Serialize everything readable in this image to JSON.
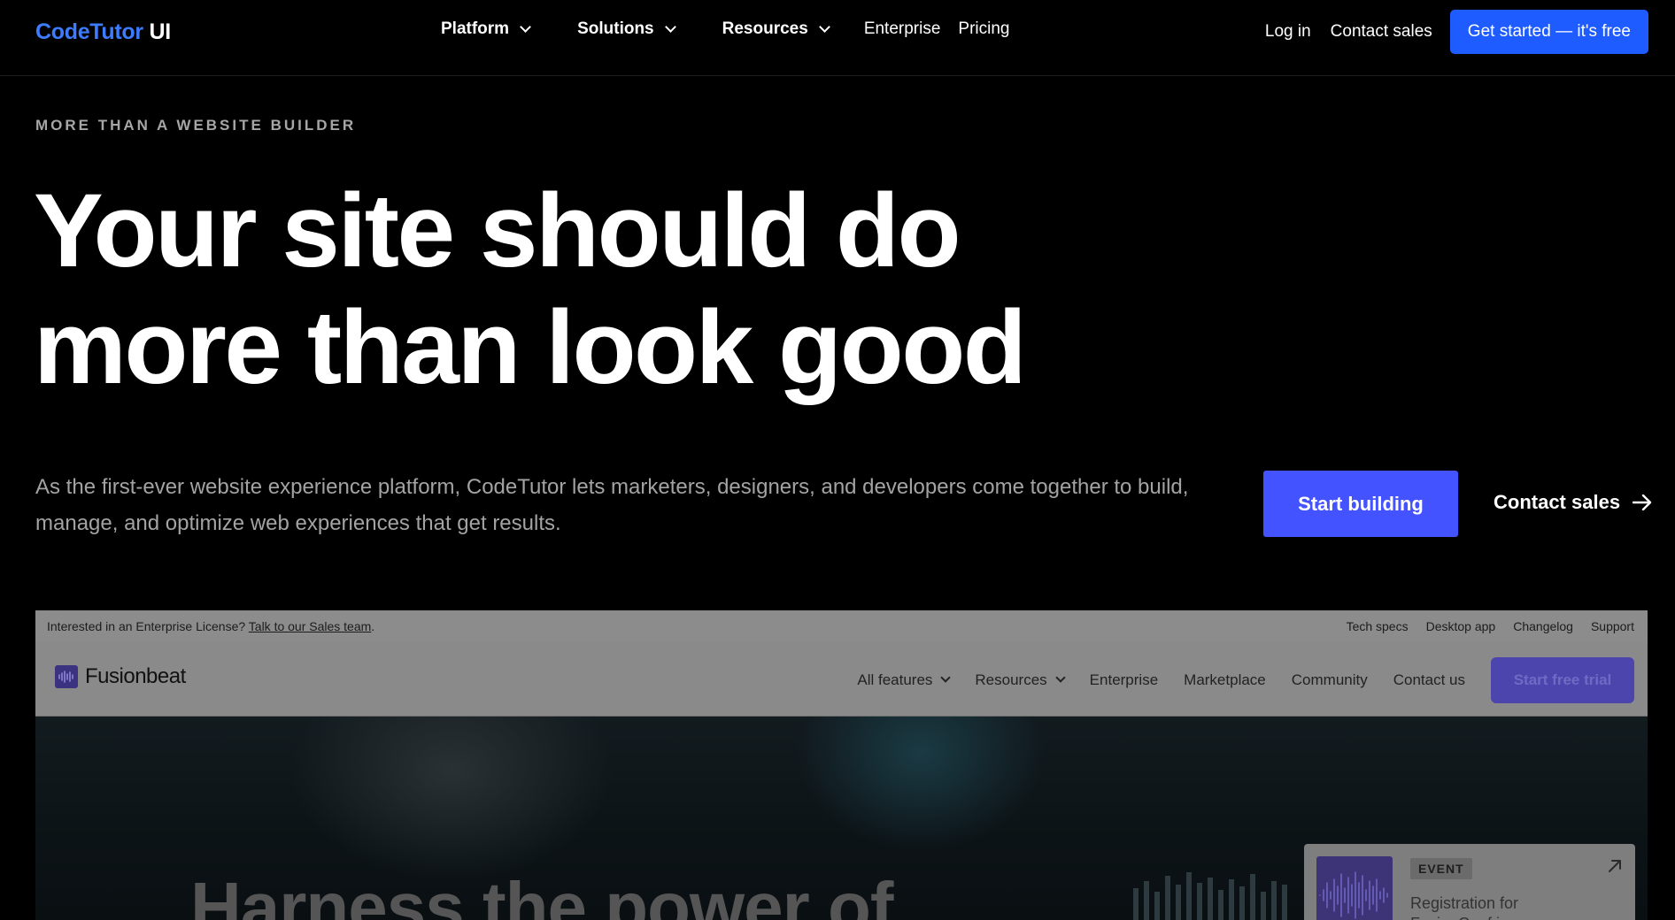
{
  "nav": {
    "logo_brand": "CodeTutor",
    "logo_suffix": "UI",
    "items": [
      {
        "label": "Platform",
        "dropdown": true
      },
      {
        "label": "Solutions",
        "dropdown": true
      },
      {
        "label": "Resources",
        "dropdown": true
      },
      {
        "label": "Enterprise",
        "dropdown": false
      },
      {
        "label": "Pricing",
        "dropdown": false
      }
    ],
    "login": "Log in",
    "contact": "Contact sales",
    "cta": "Get started — it's free"
  },
  "hero": {
    "eyebrow": "MORE THAN A WEBSITE BUILDER",
    "headline_line1": "Your site should do",
    "headline_line2": "more than look good",
    "lede": "As the first-ever website experience platform, CodeTutor lets marketers, designers, and developers come together to build, manage, and optimize web experiences that get results.",
    "primary_cta": "Start building",
    "secondary_cta": "Contact sales"
  },
  "preview": {
    "topbar": {
      "text": "Interested in an Enterprise License?",
      "link": "Talk to our Sales team",
      "suffix": ".",
      "links": [
        "Tech specs",
        "Desktop app",
        "Changelog",
        "Support"
      ]
    },
    "logo": "Fusionbeat",
    "nav": [
      {
        "label": "All features",
        "dropdown": true
      },
      {
        "label": "Resources",
        "dropdown": true
      },
      {
        "label": "Enterprise",
        "dropdown": false
      },
      {
        "label": "Marketplace",
        "dropdown": false
      },
      {
        "label": "Community",
        "dropdown": false
      },
      {
        "label": "Contact us",
        "dropdown": false
      }
    ],
    "trial_button": "Start free trial",
    "event": {
      "tag": "EVENT",
      "title": "Registration for FusionConf is open"
    },
    "hero_text": "Harness the power of"
  },
  "colors": {
    "brand_blue": "#3d7bff",
    "cta_blue": "#1f5cff",
    "start_button": "#4353ff",
    "background": "#000000"
  }
}
